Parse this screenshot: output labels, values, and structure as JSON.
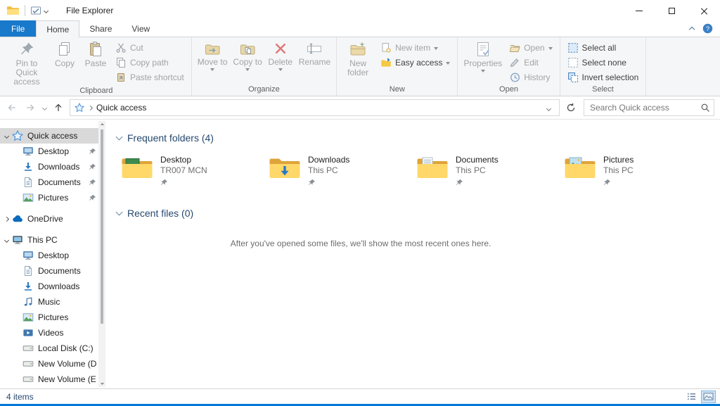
{
  "colors": {
    "file_tab_blue": "#1979ca",
    "accent_blue": "#0078d7",
    "folder_yellow": "#ffd869",
    "selection_gray": "#d9d9d9",
    "disabled_text": "#a3a3a3",
    "taskbar_strip_blue": "#0078d7"
  },
  "icons": [
    "app-folder",
    "qat-properties",
    "qat-customize-chevron",
    "minimize",
    "maximize",
    "close",
    "help",
    "minimize-ribbon-chevron",
    "pushpin",
    "copy",
    "paste",
    "cut-scissors",
    "copy-path",
    "paste-shortcut",
    "move-to-folder",
    "copy-to-folder",
    "delete-x",
    "rename",
    "new-folder",
    "new-item",
    "easy-access",
    "properties",
    "open-folder",
    "edit-pencil",
    "history-clock",
    "select-all",
    "select-none",
    "invert-selection",
    "back-arrow",
    "forward-arrow",
    "recent-locations-chevron",
    "up-arrow",
    "quick-access-star",
    "breadcrumb-chevron",
    "address-dropdown-chevron",
    "refresh",
    "search-magnifier",
    "desktop-monitor",
    "downloads-arrow",
    "documents-page",
    "pictures-photo",
    "onedrive-cloud",
    "this-pc-computer",
    "music-note",
    "videos-film",
    "disk-drive",
    "section-chevron",
    "details-view",
    "thumbnails-view"
  ],
  "titlebar": {
    "title": "File Explorer"
  },
  "ribbon": {
    "tabs": [
      {
        "label": "File"
      },
      {
        "label": "Home"
      },
      {
        "label": "Share"
      },
      {
        "label": "View"
      }
    ],
    "clipboard": {
      "label": "Clipboard",
      "pin": "Pin to Quick access",
      "copy": "Copy",
      "paste": "Paste",
      "cut": "Cut",
      "copy_path": "Copy path",
      "paste_shortcut": "Paste shortcut"
    },
    "organize": {
      "label": "Organize",
      "move_to": "Move to",
      "copy_to": "Copy to",
      "delete": "Delete",
      "rename": "Rename"
    },
    "new": {
      "label": "New",
      "new_folder": "New folder",
      "new_item": "New item",
      "easy_access": "Easy access"
    },
    "open": {
      "label": "Open",
      "properties": "Properties",
      "open": "Open",
      "edit": "Edit",
      "history": "History"
    },
    "select": {
      "label": "Select",
      "select_all": "Select all",
      "select_none": "Select none",
      "invert": "Invert selection"
    }
  },
  "addressbar": {
    "breadcrumb": "Quick access",
    "search_placeholder": "Search Quick access"
  },
  "sidebar": {
    "items": [
      {
        "label": "Quick access",
        "level": 0,
        "icon": "quick-access-star",
        "selected": true,
        "expanded": true
      },
      {
        "label": "Desktop",
        "level": 1,
        "icon": "desktop-monitor",
        "pinned": true
      },
      {
        "label": "Downloads",
        "level": 1,
        "icon": "downloads-arrow",
        "pinned": true
      },
      {
        "label": "Documents",
        "level": 1,
        "icon": "documents-page",
        "pinned": true
      },
      {
        "label": "Pictures",
        "level": 1,
        "icon": "pictures-photo",
        "pinned": true
      },
      {
        "label": "OneDrive",
        "level": 0,
        "icon": "onedrive-cloud",
        "expanded": false
      },
      {
        "label": "This PC",
        "level": 0,
        "icon": "this-pc-computer",
        "expanded": true
      },
      {
        "label": "Desktop",
        "level": 1,
        "icon": "desktop-monitor"
      },
      {
        "label": "Documents",
        "level": 1,
        "icon": "documents-page"
      },
      {
        "label": "Downloads",
        "level": 1,
        "icon": "downloads-arrow"
      },
      {
        "label": "Music",
        "level": 1,
        "icon": "music-note"
      },
      {
        "label": "Pictures",
        "level": 1,
        "icon": "pictures-photo"
      },
      {
        "label": "Videos",
        "level": 1,
        "icon": "videos-film"
      },
      {
        "label": "Local Disk (C:)",
        "level": 1,
        "icon": "disk-drive"
      },
      {
        "label": "New Volume (D:",
        "level": 1,
        "icon": "disk-drive"
      },
      {
        "label": "New Volume (E:",
        "level": 1,
        "icon": "disk-drive"
      }
    ]
  },
  "content": {
    "frequent": {
      "title": "Frequent folders (4)",
      "tiles": [
        {
          "name": "Desktop",
          "location": "TR007 MCN",
          "pinned": true
        },
        {
          "name": "Downloads",
          "location": "This PC",
          "pinned": true
        },
        {
          "name": "Documents",
          "location": "This PC",
          "pinned": true
        },
        {
          "name": "Pictures",
          "location": "This PC",
          "pinned": true
        }
      ]
    },
    "recent": {
      "title": "Recent files (0)",
      "empty_message": "After you've opened some files, we'll show the most recent ones here."
    }
  },
  "statusbar": {
    "items_count": "4 items"
  }
}
